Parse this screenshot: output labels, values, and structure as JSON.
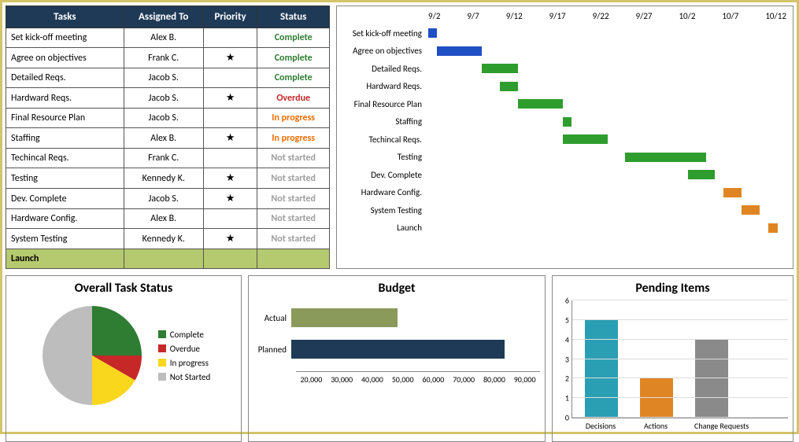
{
  "table": {
    "headers": [
      "Tasks",
      "Assigned To",
      "Priority",
      "Status"
    ],
    "rows": [
      {
        "task": "Set kick-off meeting",
        "assignee": "Alex B.",
        "priority": "",
        "status": "Complete",
        "statusClass": "status-complete"
      },
      {
        "task": "Agree on objectives",
        "assignee": "Frank C.",
        "priority": "★",
        "status": "Complete",
        "statusClass": "status-complete"
      },
      {
        "task": "Detailed Reqs.",
        "assignee": "Jacob S.",
        "priority": "",
        "status": "Complete",
        "statusClass": "status-complete"
      },
      {
        "task": "Hardward Reqs.",
        "assignee": "Jacob S.",
        "priority": "★",
        "status": "Overdue",
        "statusClass": "status-overdue"
      },
      {
        "task": "Final Resource Plan",
        "assignee": "Jacob S.",
        "priority": "",
        "status": "In progress",
        "statusClass": "status-inprogress"
      },
      {
        "task": "Staffing",
        "assignee": "Alex B.",
        "priority": "★",
        "status": "In progress",
        "statusClass": "status-inprogress"
      },
      {
        "task": "Techincal Reqs.",
        "assignee": "Frank C.",
        "priority": "",
        "status": "Not started",
        "statusClass": "status-notstarted"
      },
      {
        "task": "Testing",
        "assignee": "Kennedy K.",
        "priority": "★",
        "status": "Not started",
        "statusClass": "status-notstarted"
      },
      {
        "task": "Dev. Complete",
        "assignee": "Jacob S.",
        "priority": "★",
        "status": "Not started",
        "statusClass": "status-notstarted"
      },
      {
        "task": "Hardware Config.",
        "assignee": "Alex B.",
        "priority": "",
        "status": "Not started",
        "statusClass": "status-notstarted"
      },
      {
        "task": "System Testing",
        "assignee": "Kennedy K.",
        "priority": "★",
        "status": "Not started",
        "statusClass": "status-notstarted"
      }
    ],
    "launchLabel": "Launch"
  },
  "gantt": {
    "dates": [
      "9/2",
      "9/7",
      "9/12",
      "9/17",
      "9/22",
      "9/27",
      "10/2",
      "10/7",
      "10/12"
    ],
    "tasks": [
      "Set kick-off meeting",
      "Agree on objectives",
      "Detailed Reqs.",
      "Hardward Reqs.",
      "Final Resource Plan",
      "Staffing",
      "Techincal Reqs.",
      "Testing",
      "Dev. Complete",
      "Hardware Config.",
      "System Testing",
      "Launch"
    ]
  },
  "pie": {
    "title": "Overall Task Status",
    "legend": [
      {
        "label": "Complete",
        "color": "#2e7d32"
      },
      {
        "label": "Overdue",
        "color": "#c62828"
      },
      {
        "label": "In progress",
        "color": "#f9d71c"
      },
      {
        "label": "Not Started",
        "color": "#bdbdbd"
      }
    ]
  },
  "budget": {
    "title": "Budget",
    "rows": [
      {
        "label": "Actual",
        "value": 50000,
        "color": "#8a9a5b"
      },
      {
        "label": "Planned",
        "value": 80000,
        "color": "#1f3a56"
      }
    ],
    "ticks": [
      "20,000",
      "30,000",
      "40,000",
      "50,000",
      "60,000",
      "70,000",
      "80,000",
      "90,000"
    ]
  },
  "pending": {
    "title": "Pending Items",
    "bars": [
      {
        "label": "Decisions",
        "value": 5,
        "color": "#2a9fb3"
      },
      {
        "label": "Actions",
        "value": 2,
        "color": "#e08524"
      },
      {
        "label": "Change Requests",
        "value": 4,
        "color": "#8a8a8a"
      }
    ],
    "ymax": 6
  },
  "chart_data": [
    {
      "type": "gantt",
      "title": "",
      "x_dates": [
        "9/2",
        "9/7",
        "9/12",
        "9/17",
        "9/22",
        "9/27",
        "10/2",
        "10/7",
        "10/12"
      ],
      "bars": [
        {
          "task": "Set kick-off meeting",
          "start": "9/2",
          "end": "9/3",
          "color": "blue"
        },
        {
          "task": "Agree on objectives",
          "start": "9/3",
          "end": "9/8",
          "color": "blue"
        },
        {
          "task": "Detailed Reqs.",
          "start": "9/8",
          "end": "9/12",
          "color": "green"
        },
        {
          "task": "Hardward Reqs.",
          "start": "9/10",
          "end": "9/12",
          "color": "green"
        },
        {
          "task": "Final Resource Plan",
          "start": "9/12",
          "end": "9/17",
          "color": "green"
        },
        {
          "task": "Staffing",
          "start": "9/17",
          "end": "9/18",
          "color": "green"
        },
        {
          "task": "Techincal Reqs.",
          "start": "9/17",
          "end": "9/22",
          "color": "green"
        },
        {
          "task": "Testing",
          "start": "9/24",
          "end": "10/3",
          "color": "green"
        },
        {
          "task": "Dev. Complete",
          "start": "10/1",
          "end": "10/4",
          "color": "green"
        },
        {
          "task": "Hardware Config.",
          "start": "10/5",
          "end": "10/7",
          "color": "orange"
        },
        {
          "task": "System Testing",
          "start": "10/7",
          "end": "10/9",
          "color": "orange"
        },
        {
          "task": "Launch",
          "start": "10/10",
          "end": "10/11",
          "color": "orange"
        }
      ]
    },
    {
      "type": "pie",
      "title": "Overall Task Status",
      "series": [
        {
          "name": "Complete",
          "value": 3,
          "color": "#2e7d32"
        },
        {
          "name": "Overdue",
          "value": 1,
          "color": "#c62828"
        },
        {
          "name": "In progress",
          "value": 2,
          "color": "#f9d71c"
        },
        {
          "name": "Not Started",
          "value": 6,
          "color": "#bdbdbd"
        }
      ]
    },
    {
      "type": "bar",
      "orientation": "horizontal",
      "title": "Budget",
      "categories": [
        "Actual",
        "Planned"
      ],
      "values": [
        50000,
        80000
      ],
      "xlim": [
        20000,
        90000
      ]
    },
    {
      "type": "bar",
      "title": "Pending Items",
      "categories": [
        "Decisions",
        "Actions",
        "Change Requests"
      ],
      "values": [
        5,
        2,
        4
      ],
      "ylim": [
        0,
        6
      ]
    }
  ]
}
